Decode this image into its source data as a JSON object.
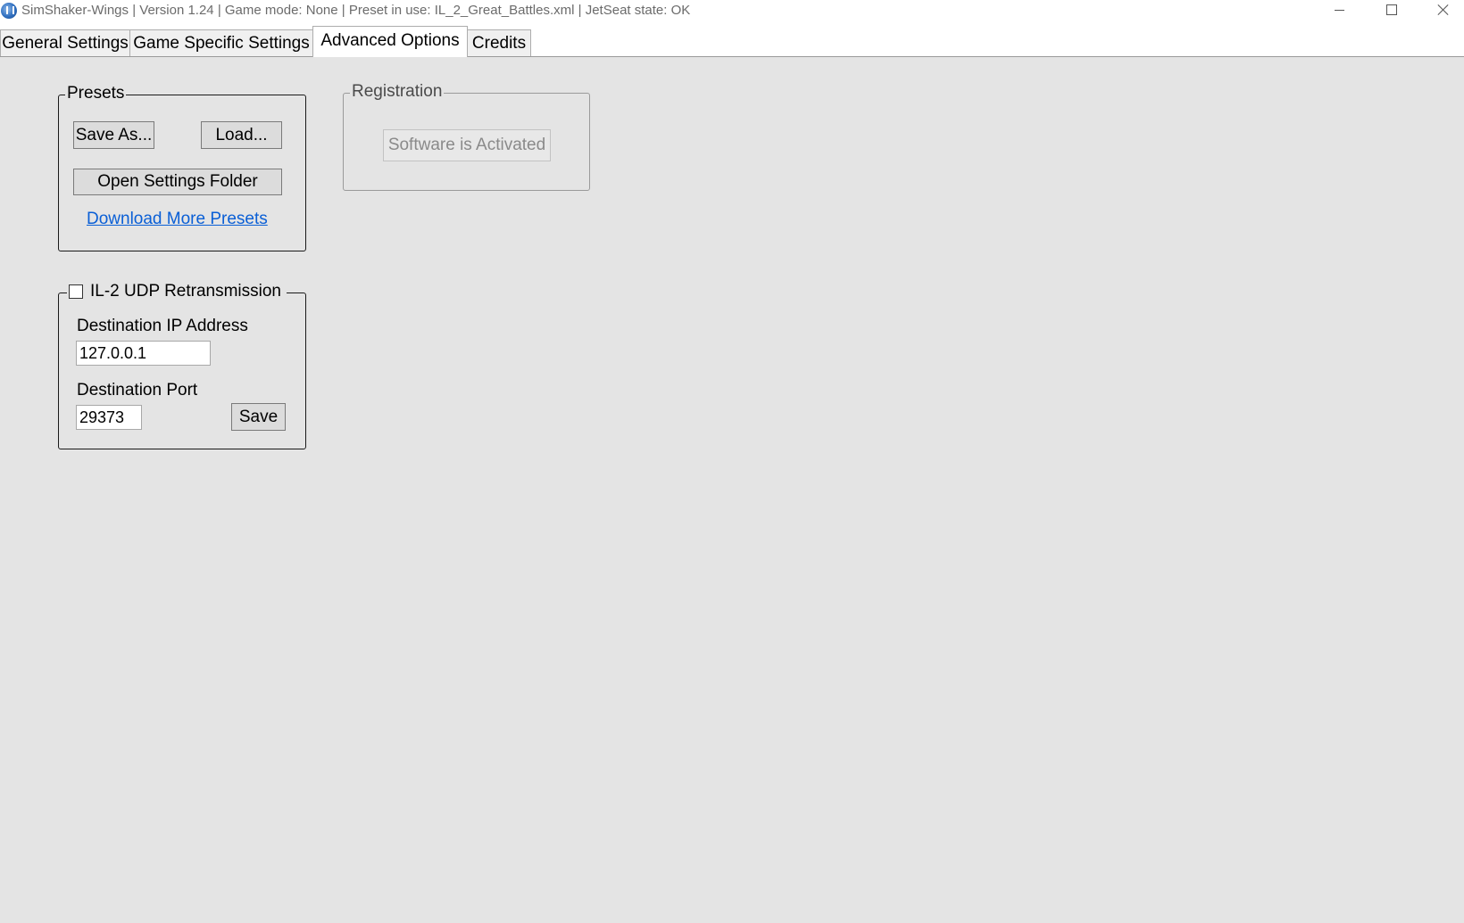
{
  "window": {
    "title": "SimShaker-Wings | Version 1.24 | Game mode: None | Preset in use: IL_2_Great_Battles.xml | JetSeat state: OK"
  },
  "tabs": [
    {
      "label": "General Settings",
      "active": false
    },
    {
      "label": "Game Specific Settings",
      "active": false
    },
    {
      "label": "Advanced Options",
      "active": true
    },
    {
      "label": "Credits",
      "active": false
    }
  ],
  "presets": {
    "title": "Presets",
    "save_as_label": "Save As...",
    "load_label": "Load...",
    "open_folder_label": "Open Settings Folder",
    "download_link": "Download More Presets"
  },
  "registration": {
    "title": "Registration",
    "status_button": "Software is Activated"
  },
  "udp": {
    "title": "IL-2 UDP Retransmission",
    "checked": false,
    "ip_label": "Destination IP Address",
    "ip_value": "127.0.0.1",
    "port_label": "Destination Port",
    "port_value": "29373",
    "save_label": "Save"
  },
  "colors": {
    "background": "#e4e4e4",
    "link": "#0a5fd6"
  }
}
